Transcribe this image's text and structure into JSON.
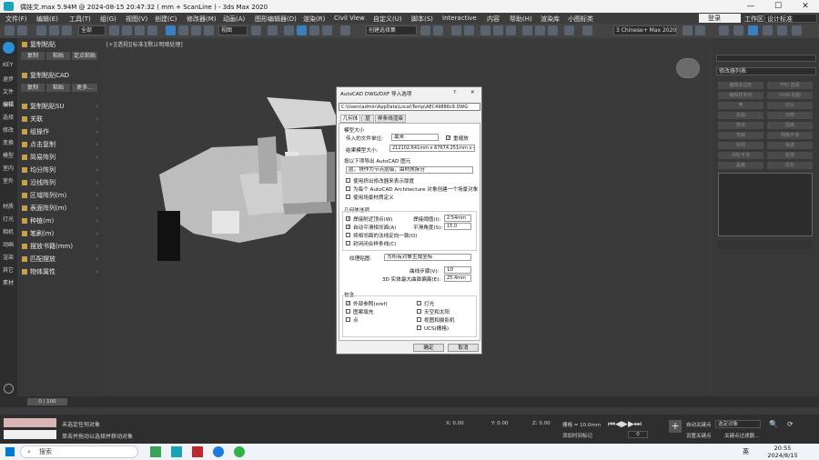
{
  "window": {
    "title": "偶娃文.max  5.94M @ 2024-08-15 20:47:32  ( mm + ScanLine )  -  3ds Max 2020",
    "minimize": "—",
    "maximize": "☐",
    "close": "✕"
  },
  "menu": [
    "文件(F)",
    "编辑(E)",
    "工具(T)",
    "组(G)",
    "视图(V)",
    "创建(C)",
    "修改器(M)",
    "动画(A)",
    "图形编辑器(D)",
    "渲染(R)",
    "Civil View",
    "自定义(U)",
    "脚本(S)",
    "Interactive",
    "内容",
    "帮助(H)",
    "渲染库",
    "小图标类"
  ],
  "menu_right": {
    "login": "登录",
    "workspace_label": "工作区:",
    "workspace_value": "设计标准"
  },
  "toolbar": {
    "filter": "全部",
    "view": "视图",
    "selection_set": "创建选择集",
    "workspace": "3 Chinese+ Max 2020"
  },
  "left_strip": [
    "KEY",
    "退步",
    "文件",
    "编辑",
    "选择",
    "修改",
    "变换",
    "模型",
    "室内",
    "室外",
    "材质",
    "灯光",
    "相机",
    "动画",
    "渲染",
    "其它",
    "素材"
  ],
  "left_panel": {
    "copy_paste": {
      "title": "复制粘贴",
      "buttons": [
        "复制",
        "粘贴",
        "定点粘贴"
      ]
    },
    "copy_paste_cad": {
      "title": "复制粘贴CAD",
      "buttons": [
        "复制",
        "粘贴",
        "更多..."
      ]
    },
    "sections": [
      "复制粘贴SU",
      "关联",
      "组操作",
      "点击复制",
      "简易阵列",
      "均分阵列",
      "沿线阵列",
      "区域阵列(m)",
      "表面阵列(m)",
      "种植(m)",
      "笔刷(m)",
      "摆放书籍(mm)",
      "匹配摆放",
      "物体属性"
    ]
  },
  "viewport": {
    "label": "[+][透视][标准][默认明暗处理]"
  },
  "dialog": {
    "title": "AutoCAD DWG/DXF 导入选项",
    "help": "?",
    "close": "✕",
    "path": "C:\\Users\\admin\\AppData\\Local\\Temp\\AEC49886c9.DWG",
    "tabs": [
      "几何体",
      "层",
      "样条线渲染"
    ],
    "model_size": "模型大小",
    "units_label": "传入的文件单位:",
    "units_value": "毫米",
    "rescale": "重缩放",
    "result_size_label": "结果模型大小:",
    "result_size_value": "212102.641mm x 67674.251mm x 4000",
    "derive_label": "按以下项导出 AutoCAD 图元",
    "derive_value": "层，块作为节点层级，由材质拆分",
    "options": [
      "使用挤出修改器来表示厚度",
      "为每个 AutoCAD Architecture 对象创建一个场景对象",
      "使用场景材质定义"
    ],
    "geometry_label": "几何体选项",
    "geom_options": [
      {
        "label": "焊接附近顶点(W)",
        "checked": true
      },
      {
        "label": "自动平滑相邻面(A)",
        "checked": true
      },
      {
        "label": "将相邻面的法线定向一致(O)",
        "checked": false
      },
      {
        "label": "封闭闭合样条线(C)",
        "checked": false
      }
    ],
    "weld_threshold_label": "焊接阈值(I):",
    "weld_threshold": "2.54mm",
    "smooth_angle_label": "平滑角度(S):",
    "smooth_angle": "15.0",
    "texture_label": "纹理贴图:",
    "texture_value": "为所有对象生成坐标",
    "curve_steps_label": "曲线步骤(V):",
    "curve_steps": "10",
    "max_angle_label": "3D 实体最大曲面偏离(E):",
    "max_angle": "25.4mm",
    "include_label": "包含",
    "include_left": [
      {
        "label": "外部参照(xref)",
        "checked": true
      },
      {
        "label": "图案填充",
        "checked": false
      },
      {
        "label": "点",
        "checked": false
      }
    ],
    "include_right": [
      {
        "label": "灯光",
        "checked": false
      },
      {
        "label": "天空和太阳",
        "checked": false
      },
      {
        "label": "视图和摄影机",
        "checked": false
      },
      {
        "label": "UCS(栅格)",
        "checked": false
      }
    ],
    "ok": "确定",
    "cancel": "取消"
  },
  "right_panel": {
    "modifier_list": "修改器列表",
    "buttons": [
      "编辑多边形",
      "FFD 选择",
      "编辑样条线",
      "UVW 贴图",
      "壳",
      "切片",
      "车削",
      "对称",
      "挤出",
      "扭曲",
      "弯曲",
      "网格平滑",
      "补洞",
      "噪波",
      "涡轮平滑",
      "松弛",
      "晶格",
      "优化"
    ]
  },
  "status": {
    "frame": "0 / 100",
    "line1": "未选定任何对象",
    "line2": "单击并拖动以选择并移动对象",
    "x": "X: 0.00",
    "y": "Y: 0.00",
    "z": "Z: 0.00",
    "grid": "栅格 = 10.0mm",
    "time_tag": "添加时间标记",
    "auto_key": "自动关键点",
    "selected": "选定对象",
    "set_key": "设置关键点",
    "key_filter": "关键点过滤器...",
    "frame_num": "0"
  },
  "taskbar": {
    "search": "搜索",
    "lang": "英",
    "time": "20:55",
    "date": "2024/8/15"
  }
}
